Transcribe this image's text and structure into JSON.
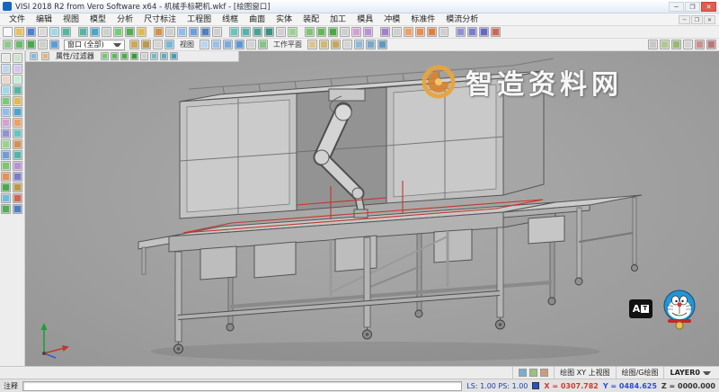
{
  "window": {
    "title": "VISI 2018 R2 from Vero Software x64 - 机械手标靶机.wkf - [绘图窗口]",
    "controls": {
      "minimize": "─",
      "maximize": "❐",
      "close": "✕"
    }
  },
  "menubar": {
    "items": [
      "文件",
      "编辑",
      "视图",
      "模型",
      "分析",
      "尺寸标注",
      "工程图",
      "线框",
      "曲面",
      "实体",
      "装配",
      "加工",
      "模具",
      "冲模",
      "标准件",
      "模流分析"
    ],
    "doc_controls": {
      "minimize": "─",
      "restore": "❐",
      "close": "✕"
    }
  },
  "toolbar1": {
    "icons": [
      "#f8f8f8",
      "#e6c25c",
      "#4f7fd0",
      "#d9d9d9",
      "#9fd8e8",
      "#57b3a2",
      "#57b3a2",
      "#4aa4cc",
      "#cfcfcf",
      "#7cc87c",
      "#57aa57",
      "#dcbb52",
      "#d19250",
      "#cfcfcf",
      "#93bce8",
      "#6f9ed4",
      "#4f7fbc",
      "#cfcfcf",
      "#68c4ba",
      "#59b2a8",
      "#4aa096",
      "#3d8e84",
      "#cfcfcf",
      "#9cd291",
      "#80c477",
      "#64b65d",
      "#48a843",
      "#cfcfcf",
      "#d2a2d2",
      "#ba91d2",
      "#a280ca",
      "#cfcfcf",
      "#eaa268",
      "#e29157",
      "#da8046",
      "#cfcfcf",
      "#9191d2",
      "#7c7cca",
      "#6868c2",
      "#c86a5a"
    ]
  },
  "toolbar2": {
    "left_icons": [
      "#8fc98f",
      "#6db86d",
      "#4da74d",
      "#cfcfcf",
      "#5a9fd4"
    ],
    "window_combo": "窗口 (全部)",
    "mid_icons": [
      "#c9a95a",
      "#b89a4e",
      "#d4d4d4",
      "#7ab8d8"
    ],
    "view_label": "视图",
    "view_icons": [
      "#bcd4ec",
      "#9cc0e4",
      "#7cacdc",
      "#5c98d4",
      "#d4d4d4",
      "#88c288"
    ],
    "workplane_label": "工作平面",
    "wp_icons": [
      "#d8c890",
      "#ccb878",
      "#c0a860",
      "#d4d4d4",
      "#90b8d8",
      "#78a8cc",
      "#6098c0"
    ],
    "right_icons": [
      "#c8c8c8",
      "#b0c890",
      "#98b878",
      "#d4d4d4",
      "#c89090",
      "#b87878"
    ]
  },
  "left_toolbar": {
    "icons": [
      "#e8e8e8",
      "#cfe2cf",
      "#bcd6ec",
      "#d6c6ec",
      "#ecd6c6",
      "#c6ecd6",
      "#9fd8e8",
      "#57b3a2",
      "#7cc87c",
      "#dcbb52",
      "#93bce8",
      "#4aa4cc",
      "#d2a2d2",
      "#eaa268",
      "#9191d2",
      "#68c4ba",
      "#9cd291",
      "#d19250",
      "#6f9ed4",
      "#59b2a8",
      "#80c477",
      "#ba91d2",
      "#e29157",
      "#7c7cca",
      "#4da74d",
      "#b89a4e",
      "#7ab8d8",
      "#c86a5a",
      "#57aa57",
      "#4f7fbc"
    ]
  },
  "tabstrip": {
    "label": "属性/过滤器",
    "icons": [
      "#79c279",
      "#63b563",
      "#4da84d",
      "#379b37",
      "#d0d0d0",
      "#79b8c2",
      "#63aab5",
      "#4d9ca8"
    ]
  },
  "viewport": {
    "watermark_text": "智造资料网",
    "at_icon_a": "A",
    "at_icon_t": "T"
  },
  "statusbar": {
    "row1": {
      "icons": [
        "#7aaecf",
        "#9cc27a",
        "#cf9c7a"
      ],
      "view": "绘图 XY 上视图",
      "mode": "绘图/G绘图",
      "layer": "LAYER0"
    },
    "row2": {
      "prompt_label": "注释",
      "input_value": "",
      "scale": "LS: 1.00 PS: 1.00",
      "coord_x": "X = 0307.782",
      "coord_y": "Y = 0484.625",
      "coord_z": "Z = 0000.000"
    }
  },
  "colors": {
    "red_line": "#c43527",
    "watermark_orange": "#e8a43c",
    "viewport_bg": "#a1a1a1"
  }
}
